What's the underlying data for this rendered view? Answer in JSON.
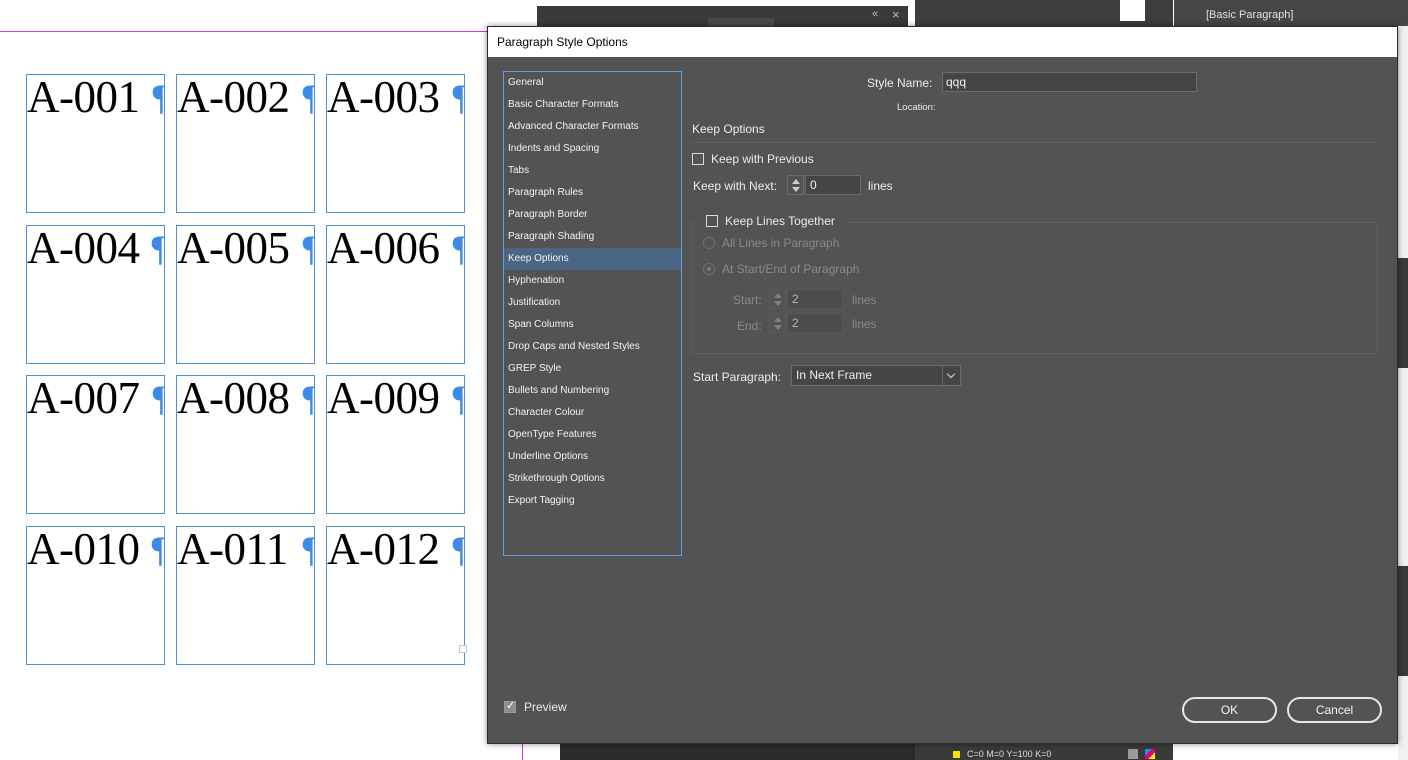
{
  "document": {
    "frames": [
      {
        "text": "A-001"
      },
      {
        "text": "A-002"
      },
      {
        "text": "A-003"
      },
      {
        "text": "A-004"
      },
      {
        "text": "A-005"
      },
      {
        "text": "A-006"
      },
      {
        "text": "A-007"
      },
      {
        "text": "A-008"
      },
      {
        "text": "A-009"
      },
      {
        "text": "A-010"
      },
      {
        "text": "A-011"
      },
      {
        "text": "A-012"
      }
    ],
    "pilcrow": "¶"
  },
  "background_panels": {
    "paragraph_styles_item": "[Basic Paragraph]",
    "swatch_label": "C=0 M=0 Y=100 K=0",
    "collapse_glyph": "«",
    "close_glyph": "×"
  },
  "dialog": {
    "title": "Paragraph Style Options",
    "categories": [
      {
        "label": "General"
      },
      {
        "label": "Basic Character Formats"
      },
      {
        "label": "Advanced Character Formats"
      },
      {
        "label": "Indents and Spacing"
      },
      {
        "label": "Tabs"
      },
      {
        "label": "Paragraph Rules"
      },
      {
        "label": "Paragraph Border"
      },
      {
        "label": "Paragraph Shading"
      },
      {
        "label": "Keep Options",
        "selected": true
      },
      {
        "label": "Hyphenation"
      },
      {
        "label": "Justification"
      },
      {
        "label": "Span Columns"
      },
      {
        "label": "Drop Caps and Nested Styles"
      },
      {
        "label": "GREP Style"
      },
      {
        "label": "Bullets and Numbering"
      },
      {
        "label": "Character Colour"
      },
      {
        "label": "OpenType Features"
      },
      {
        "label": "Underline Options"
      },
      {
        "label": "Strikethrough Options"
      },
      {
        "label": "Export Tagging"
      }
    ],
    "style_name_label": "Style Name:",
    "style_name_value": "qqq",
    "location_label": "Location:",
    "section_title": "Keep Options",
    "keep_with_previous": {
      "label": "Keep with Previous",
      "checked": false
    },
    "keep_with_next": {
      "label": "Keep with Next:",
      "value": "0",
      "unit": "lines"
    },
    "keep_lines_together": {
      "label": "Keep Lines Together",
      "checked": false
    },
    "all_lines": {
      "label": "All Lines in Paragraph"
    },
    "at_start_end": {
      "label": "At Start/End of Paragraph"
    },
    "start": {
      "label": "Start:",
      "value": "2",
      "unit": "lines"
    },
    "end": {
      "label": "End:",
      "value": "2",
      "unit": "lines"
    },
    "start_paragraph": {
      "label": "Start Paragraph:",
      "value": "In Next Frame"
    },
    "preview": {
      "label": "Preview",
      "checked": true
    },
    "ok_label": "OK",
    "cancel_label": "Cancel"
  }
}
